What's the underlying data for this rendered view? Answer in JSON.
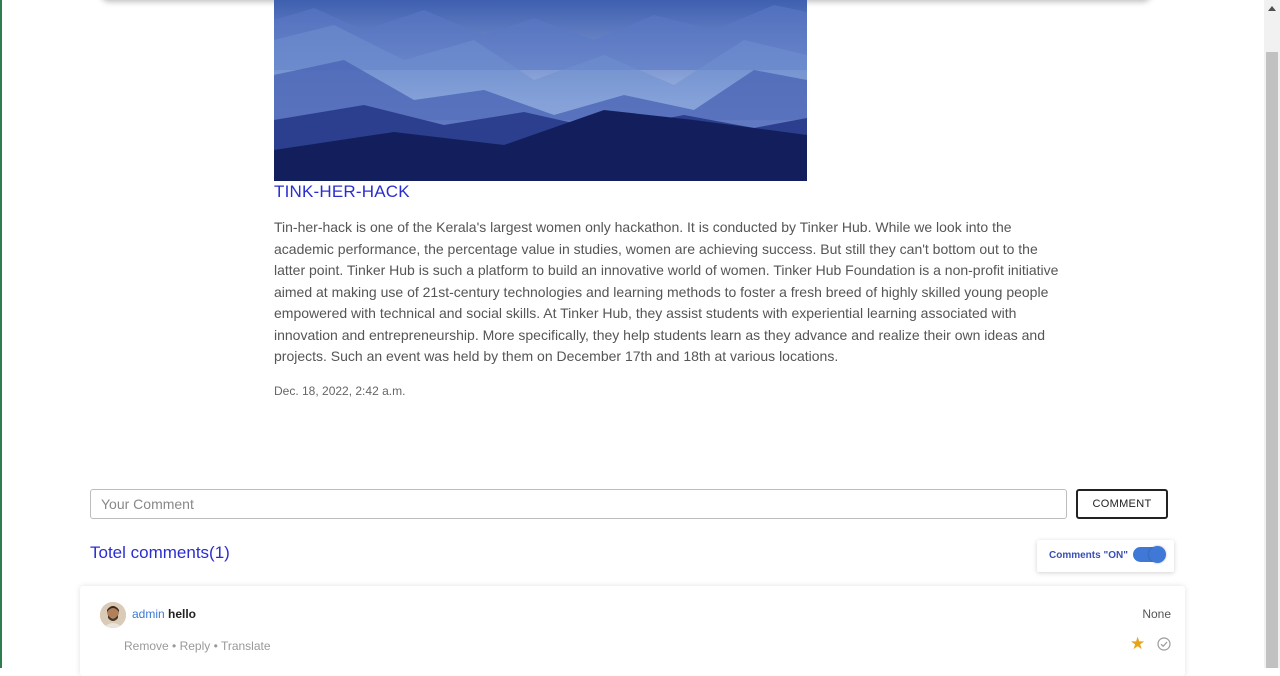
{
  "post": {
    "title": "TINK-HER-HACK",
    "body": "Tin-her-hack is one of the Kerala's largest women only hackathon. It is conducted by Tinker Hub. While we look into the academic performance, the percentage value in studies, women are achieving success.  But still they can't bottom out to the latter point. Tinker Hub is such a platform to build an innovative world of women.  Tinker Hub Foundation is a non-profit initiative aimed at making use of 21st-century technologies and learning methods to foster a fresh breed of highly skilled young people empowered with technical and social skills. At Tinker Hub, they assist students with experiential learning associated with innovation and entrepreneurship. More specifically, they help students learn as they advance and realize their own ideas and projects. Such an event was held by them on December 17th and 18th at various locations.",
    "date": "Dec. 18, 2022, 2:42 a.m."
  },
  "comment_form": {
    "placeholder": "Your Comment",
    "value": "",
    "button_label": "COMMENT"
  },
  "comments_header": {
    "total_label": "Totel comments(1)",
    "toggle_label": "Comments \"ON\"",
    "toggle_on": true
  },
  "comments": [
    {
      "user": "admin",
      "text": "hello",
      "status": "None",
      "actions": {
        "remove": "Remove",
        "reply": "Reply",
        "translate": "Translate",
        "separator": "•"
      },
      "icons": [
        "star-icon",
        "check-circle-icon"
      ]
    }
  ],
  "colors": {
    "accent": "#2a2ecf",
    "toggle": "#3f78d6",
    "star": "#e8a317"
  }
}
